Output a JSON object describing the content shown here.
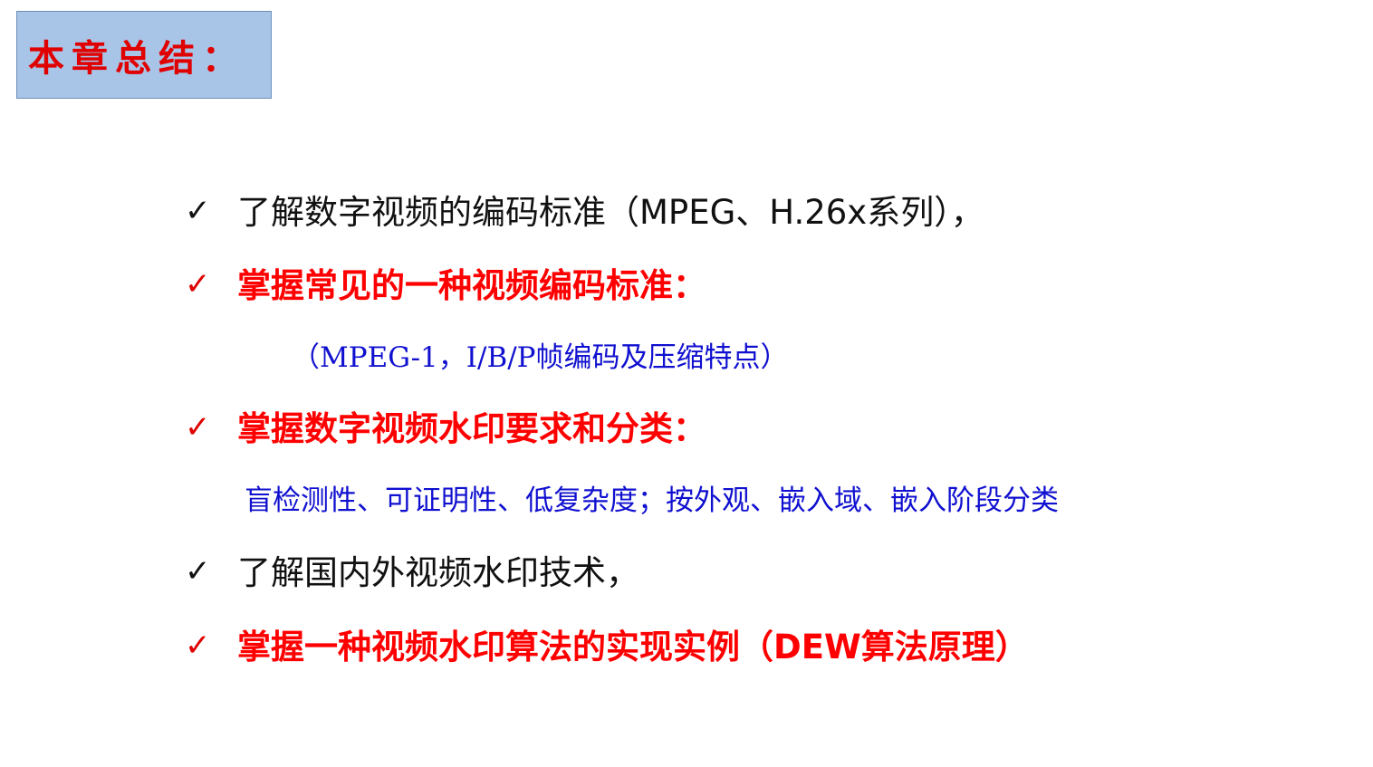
{
  "slide": {
    "title": "本章总结：",
    "items": [
      {
        "check": "✓",
        "text": "了解数字视频的编码标准（MPEG、H.26x系列），",
        "style": "black"
      },
      {
        "check": "✓",
        "text": "掌握常见的一种视频编码标准：",
        "style": "red"
      },
      {
        "text": "（MPEG-1，I/B/P帧编码及压缩特点）",
        "style": "blue"
      },
      {
        "check": "✓",
        "text": "掌握数字视频水印要求和分类：",
        "style": "red"
      },
      {
        "text": "盲检测性、可证明性、低复杂度；按外观、嵌入域、嵌入阶段分类",
        "style": "blue"
      },
      {
        "check": "✓",
        "text": "了解国内外视频水印技术，",
        "style": "black"
      },
      {
        "check": "✓",
        "text": "掌握一种视频水印算法的实现实例（DEW算法原理）",
        "style": "red"
      }
    ]
  },
  "colors": {
    "title_bg": "#a8c5e8",
    "title_text": "#e00000",
    "black_text": "#111111",
    "red_text": "#ff0000",
    "blue_text": "#1010d0"
  }
}
